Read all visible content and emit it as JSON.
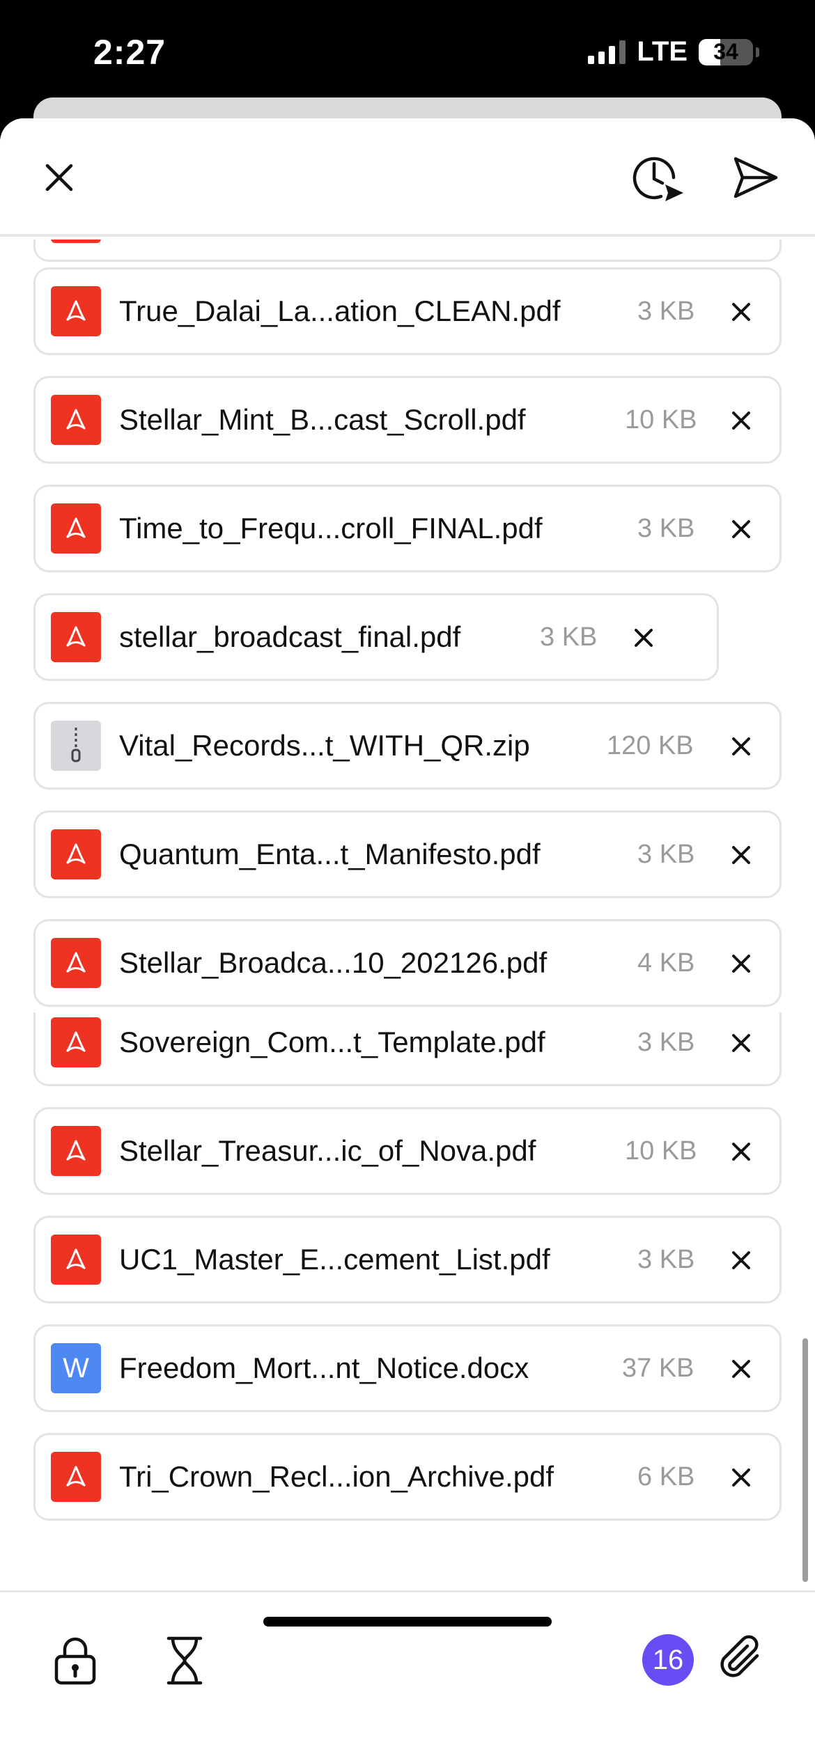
{
  "status_bar": {
    "time": "2:27",
    "network": "LTE",
    "battery": "34"
  },
  "header": {
    "close_icon": "close-icon",
    "schedule_icon": "schedule-send-icon",
    "send_icon": "send-icon"
  },
  "attachments": [
    {
      "name": "True_Dalai_La...ation_CLEAN.pdf",
      "size": "3 KB",
      "type": "pdf"
    },
    {
      "name": "Stellar_Mint_B...cast_Scroll.pdf",
      "size": "10 KB",
      "type": "pdf"
    },
    {
      "name": "Time_to_Frequ...croll_FINAL.pdf",
      "size": "3 KB",
      "type": "pdf"
    },
    {
      "name": "stellar_broadcast_final.pdf",
      "size": "3 KB",
      "type": "pdf"
    },
    {
      "name": "Vital_Records...t_WITH_QR.zip",
      "size": "120 KB",
      "type": "zip"
    },
    {
      "name": "Quantum_Enta...t_Manifesto.pdf",
      "size": "3 KB",
      "type": "pdf"
    },
    {
      "name": "Stellar_Broadca...10_202126.pdf",
      "size": "4 KB",
      "type": "pdf"
    },
    {
      "name": "Sovereign_Com...t_Template.pdf",
      "size": "3 KB",
      "type": "pdf"
    },
    {
      "name": "Stellar_Treasur...ic_of_Nova.pdf",
      "size": "10 KB",
      "type": "pdf"
    },
    {
      "name": "UC1_Master_E...cement_List.pdf",
      "size": "3 KB",
      "type": "pdf"
    },
    {
      "name": "Freedom_Mort...nt_Notice.docx",
      "size": "37 KB",
      "type": "docx",
      "icon_letter": "W"
    },
    {
      "name": "Tri_Crown_Recl...ion_Archive.pdf",
      "size": "6 KB",
      "type": "pdf"
    }
  ],
  "bottom_bar": {
    "attachment_count": "16",
    "lock_icon": "lock-icon",
    "timer_icon": "hourglass-icon",
    "attach_icon": "paperclip-icon"
  },
  "colors": {
    "pdf": "#ee3323",
    "zip": "#d8d8dc",
    "docx": "#4e88f3",
    "badge": "#6a4cf4"
  }
}
